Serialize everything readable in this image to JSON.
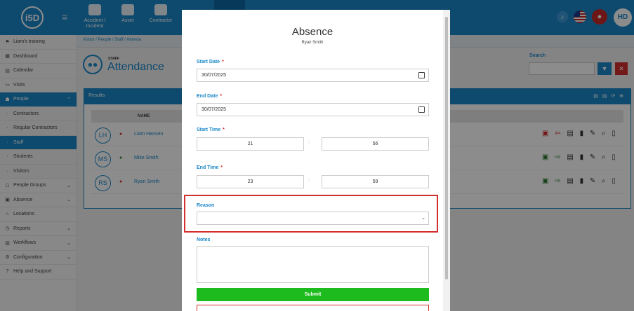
{
  "app": {
    "logo": "i5D"
  },
  "topnav": [
    {
      "label": "Accident / Incident",
      "icon": "first-aid-kit-icon"
    },
    {
      "label": "Asset",
      "icon": "boxes-icon"
    },
    {
      "label": "Contractor",
      "icon": "hard-hat-icon"
    }
  ],
  "header": {
    "avatar": "HD"
  },
  "sidebar": [
    {
      "label": "Liam's training",
      "icon": "training-icon"
    },
    {
      "label": "Dashboard",
      "icon": "dashboard-icon"
    },
    {
      "label": "Calendar",
      "icon": "calendar-icon"
    },
    {
      "label": "Visits",
      "icon": "visits-icon"
    },
    {
      "label": "People",
      "icon": "people-icon",
      "active": true
    },
    {
      "label": "Contractors",
      "sub": true
    },
    {
      "label": "Regular Contractors",
      "sub": true
    },
    {
      "label": "Staff",
      "sub": true,
      "active": true
    },
    {
      "label": "Students",
      "sub": true
    },
    {
      "label": "Visitors",
      "sub": true
    },
    {
      "label": "People Groups",
      "icon": "people-groups-icon",
      "chevron": true
    },
    {
      "label": "Absence",
      "icon": "absence-icon",
      "chevron": true
    },
    {
      "label": "Locations",
      "icon": "locations-icon"
    },
    {
      "label": "Reports",
      "icon": "reports-icon",
      "chevron": true
    },
    {
      "label": "Workflows",
      "icon": "workflows-icon",
      "chevron": true
    },
    {
      "label": "Configuration",
      "icon": "configuration-icon",
      "chevron": true
    },
    {
      "label": "Help and Support",
      "icon": "help-icon"
    }
  ],
  "breadcrumb": [
    "Visitor",
    "People",
    "Staff",
    "Attenda"
  ],
  "page": {
    "staff_label": "STAFF",
    "title": "Attendance"
  },
  "search": {
    "label": "Search"
  },
  "results": {
    "title": "Results",
    "col_name": "NAME"
  },
  "rows": [
    {
      "initials": "LH",
      "name": "Liam Hansen",
      "status": "out"
    },
    {
      "initials": "MS",
      "name": "Mike Smith",
      "status": "in"
    },
    {
      "initials": "RS",
      "name": "Ryan Smith",
      "status": "in"
    }
  ],
  "modal": {
    "title": "Absence",
    "subtitle": "Ryan Smith",
    "start_date_label": "Start Date",
    "start_date": "30/07/2025",
    "end_date_label": "End Date",
    "end_date": "30/07/2025",
    "start_time_label": "Start Time",
    "start_hour": "21",
    "start_minute": "56",
    "end_time_label": "End Time",
    "end_hour": "23",
    "end_minute": "59",
    "reason_label": "Reason",
    "reason_value": "",
    "notes_label": "Notes",
    "submit_label": "Submit",
    "required_mark": "*",
    "colon": ":"
  },
  "colors": {
    "primary": "#1a87c9",
    "submit": "#1dbb1d",
    "danger": "#d32f2f"
  }
}
